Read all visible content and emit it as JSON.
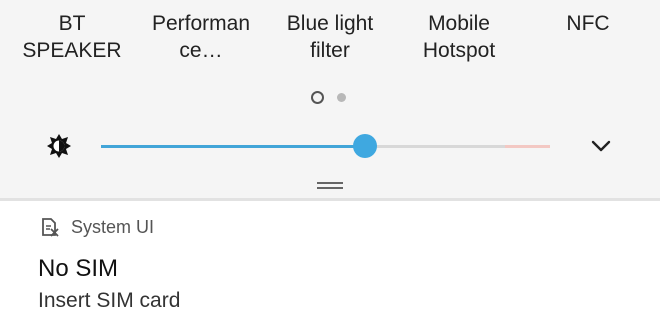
{
  "quick_settings": {
    "tiles": [
      {
        "label": "BT\nSPEAKER"
      },
      {
        "label": "Performan\nce…"
      },
      {
        "label": "Blue light\nfilter"
      },
      {
        "label": "Mobile\nHotspot"
      },
      {
        "label": "NFC"
      }
    ],
    "pager": {
      "current_page": 1,
      "total_pages": 2
    },
    "brightness": {
      "icon": "brightness-icon",
      "level": 0.59
    },
    "expand_icon": "chevron-down-icon"
  },
  "colors": {
    "accent": "#42a5d8",
    "panel_background": "#f5f5f5"
  },
  "notification": {
    "app_icon": "sim-card-icon",
    "app_name": "System UI",
    "title": "No SIM",
    "text": "Insert SIM card"
  }
}
